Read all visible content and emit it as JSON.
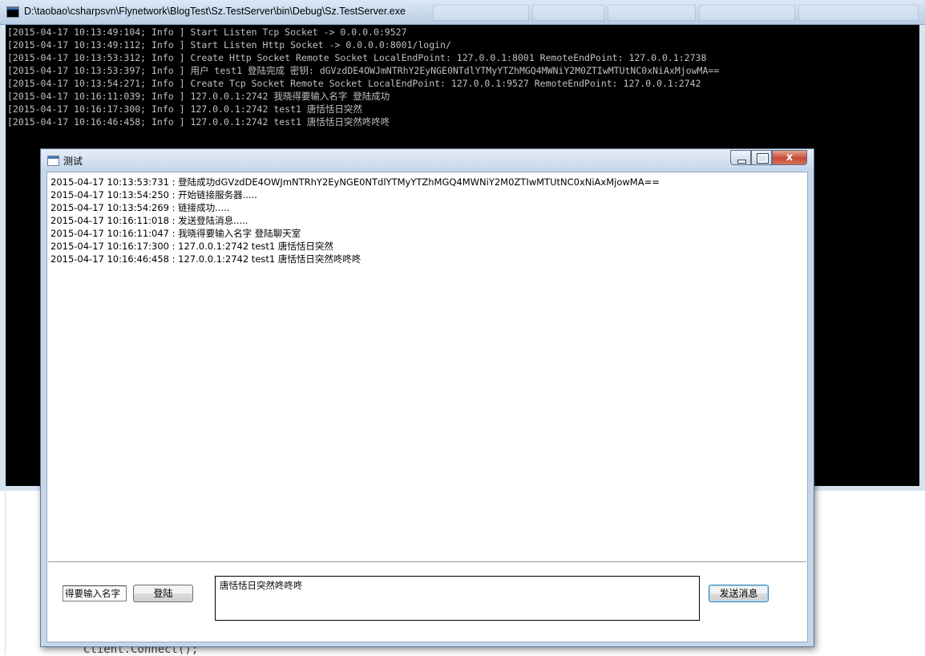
{
  "background": {
    "code_line": "Client.Connect();"
  },
  "console": {
    "title": "D:\\taobao\\csharpsvn\\Flynetwork\\BlogTest\\Sz.TestServer\\bin\\Debug\\Sz.TestServer.exe",
    "lines": [
      "[2015-04-17 10:13:49:104; Info ] Start Listen Tcp Socket -> 0.0.0.0:9527",
      "[2015-04-17 10:13:49:112; Info ] Start Listen Http Socket -> 0.0.0.0:8001/login/",
      "[2015-04-17 10:13:53:312; Info ] Create Http Socket Remote Socket LocalEndPoint: 127.0.0.1:8001 RemoteEndPoint: 127.0.0.1:2738",
      "[2015-04-17 10:13:53:397; Info ] 用户 test1 登陆完成 密钥: dGVzdDE4OWJmNTRhY2EyNGE0NTdlYTMyYTZhMGQ4MWNiY2M0ZTIwMTUtNC0xNiAxMjowMA==",
      "[2015-04-17 10:13:54:271; Info ] Create Tcp Socket Remote Socket LocalEndPoint: 127.0.0.1:9527 RemoteEndPoint: 127.0.0.1:2742",
      "[2015-04-17 10:16:11:039; Info ] 127.0.0.1:2742 我晓得要输入名字 登陆成功",
      "[2015-04-17 10:16:17:300; Info ] 127.0.0.1:2742 test1 唐恬恬日突然",
      "[2015-04-17 10:16:46:458; Info ] 127.0.0.1:2742 test1 唐恬恬日突然咚咚咚"
    ]
  },
  "dialog": {
    "title": "测试",
    "close_glyph": "x",
    "log_lines": [
      "2015-04-17 10:13:53:731 : 登陆成功dGVzdDE4OWJmNTRhY2EyNGE0NTdlYTMyYTZhMGQ4MWNiY2M0ZTIwMTUtNC0xNiAxMjowMA==",
      "2015-04-17 10:13:54:250 : 开始链接服务器.....",
      "2015-04-17 10:13:54:269 : 链接成功.....",
      "2015-04-17 10:16:11:018 : 发送登陆消息.....",
      "2015-04-17 10:16:11:047 : 我晓得要输入名字 登陆聊天室",
      "2015-04-17 10:16:17:300 : 127.0.0.1:2742 test1 唐恬恬日突然",
      "2015-04-17 10:16:46:458 : 127.0.0.1:2742 test1 唐恬恬日突然咚咚咚"
    ],
    "name_value": "得要输入名字",
    "login_label": "登陆",
    "message_value": "唐恬恬日突然咚咚咚",
    "send_label": "发送消息"
  }
}
